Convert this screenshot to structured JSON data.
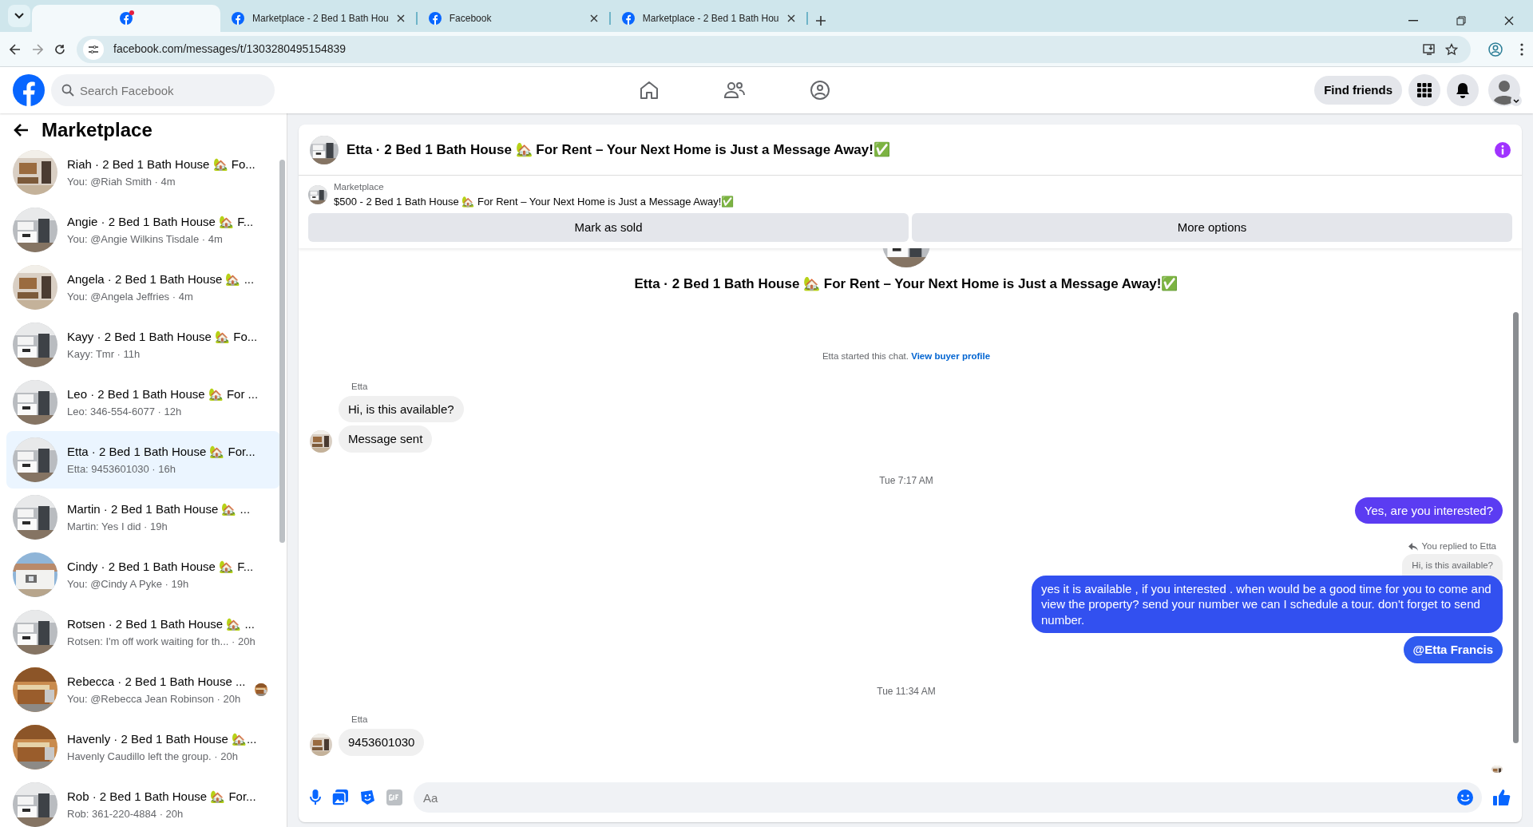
{
  "browser": {
    "tabs": [
      {
        "selected": true,
        "notify": true
      },
      {
        "title": "Marketplace - 2 Bed 1 Bath Hou",
        "selected": false,
        "notify": false
      },
      {
        "title": "Facebook",
        "selected": false,
        "notify": false
      },
      {
        "title": "Marketplace - 2 Bed 1 Bath Hou",
        "selected": false,
        "notify": false
      }
    ],
    "url": "facebook.com/messages/t/1303280495154839"
  },
  "topbar": {
    "search": {
      "placeholder": "Search Facebook"
    },
    "find_friends": "Find friends"
  },
  "sidebar": {
    "title": "Marketplace",
    "conversations": [
      {
        "title": "Riah · 2 Bed 1 Bath House 🏡 Fo...",
        "preview": "You: @Riah Smith · 4m",
        "selected": false,
        "seen": false
      },
      {
        "title": "Angie · 2 Bed 1 Bath House 🏡 F...",
        "preview": "You: @Angie Wilkins Tisdale · 4m",
        "selected": false,
        "seen": false
      },
      {
        "title": "Angela · 2 Bed 1 Bath House 🏡 ...",
        "preview": "You: @Angela Jeffries · 4m",
        "selected": false,
        "seen": false
      },
      {
        "title": "Kayy · 2 Bed 1 Bath House 🏡 Fo...",
        "preview": "Kayy: Tmr · 11h",
        "selected": false,
        "seen": false
      },
      {
        "title": "Leo · 2 Bed 1 Bath House 🏡 For ...",
        "preview": "Leo: 346-554-6077 · 12h",
        "selected": false,
        "seen": false
      },
      {
        "title": "Etta · 2 Bed 1 Bath House 🏡 For...",
        "preview": "Etta: 9453601030 · 16h",
        "selected": true,
        "seen": false
      },
      {
        "title": "Martin · 2 Bed 1 Bath House 🏡 ...",
        "preview": "Martin: Yes I did · 19h",
        "selected": false,
        "seen": false
      },
      {
        "title": "Cindy · 2 Bed 1 Bath House 🏡 F...",
        "preview": "You: @Cindy A Pyke · 19h",
        "selected": false,
        "seen": false
      },
      {
        "title": "Rotsen · 2 Bed 1 Bath House 🏡 ...",
        "preview": "Rotsen: I'm off work waiting for th... · 20h",
        "selected": false,
        "seen": false
      },
      {
        "title": "Rebecca · 2 Bed 1 Bath House ...",
        "preview": "You: @Rebecca Jean Robinson · 20h",
        "selected": false,
        "seen": true
      },
      {
        "title": "Havenly · 2 Bed 1 Bath House 🏡...",
        "preview": "Havenly Caudillo left the group. · 20h",
        "selected": false,
        "seen": false
      },
      {
        "title": "Rob · 2 Bed 1 Bath House 🏡 For...",
        "preview": "Rob: 361-220-4884 · 20h",
        "selected": false,
        "seen": false
      }
    ]
  },
  "chat": {
    "title": "Etta · 2 Bed 1 Bath House 🏡 For Rent – Your Next Home is Just a Message Away!✅",
    "listing": {
      "label": "Marketplace",
      "text": "$500 - 2 Bed 1 Bath House 🏡 For Rent – Your Next Home is Just a Message Away!✅",
      "buttons": [
        "Mark as sold",
        "More options"
      ]
    },
    "intro": {
      "title": "Etta · 2 Bed 1 Bath House 🏡 For Rent – Your Next Home is Just a Message Away!✅",
      "started": "Etta started this chat.",
      "link": "View buyer profile"
    },
    "messages": [
      {
        "kind": "sender",
        "text": "Etta"
      },
      {
        "kind": "incoming",
        "text": "Hi, is this available?",
        "avatar": false
      },
      {
        "kind": "incoming",
        "text": "Message sent",
        "avatar": true
      },
      {
        "kind": "time",
        "text": "Tue 7:17 AM"
      },
      {
        "kind": "outgoing",
        "text": "Yes, are you interested?",
        "color": "#5b3cf2"
      },
      {
        "kind": "reply_note",
        "text": "You replied to Etta"
      },
      {
        "kind": "quoted",
        "text": "Hi, is this available?"
      },
      {
        "kind": "outgoing",
        "text": "yes it is available , if you interested . when would be  a good time for you to come and view the  property? send your number we can I schedule  a tour. don't forget to send  number.",
        "color": "#3250f0"
      },
      {
        "kind": "outgoing",
        "text": "@Etta Francis",
        "color": "#2f5bf0",
        "bold": true
      },
      {
        "kind": "time",
        "text": "Tue 11:34 AM"
      },
      {
        "kind": "sender",
        "text": "Etta"
      },
      {
        "kind": "incoming",
        "text": "9453601030",
        "avatar": true
      },
      {
        "kind": "seen"
      }
    ],
    "composer": {
      "placeholder": "Aa"
    }
  }
}
